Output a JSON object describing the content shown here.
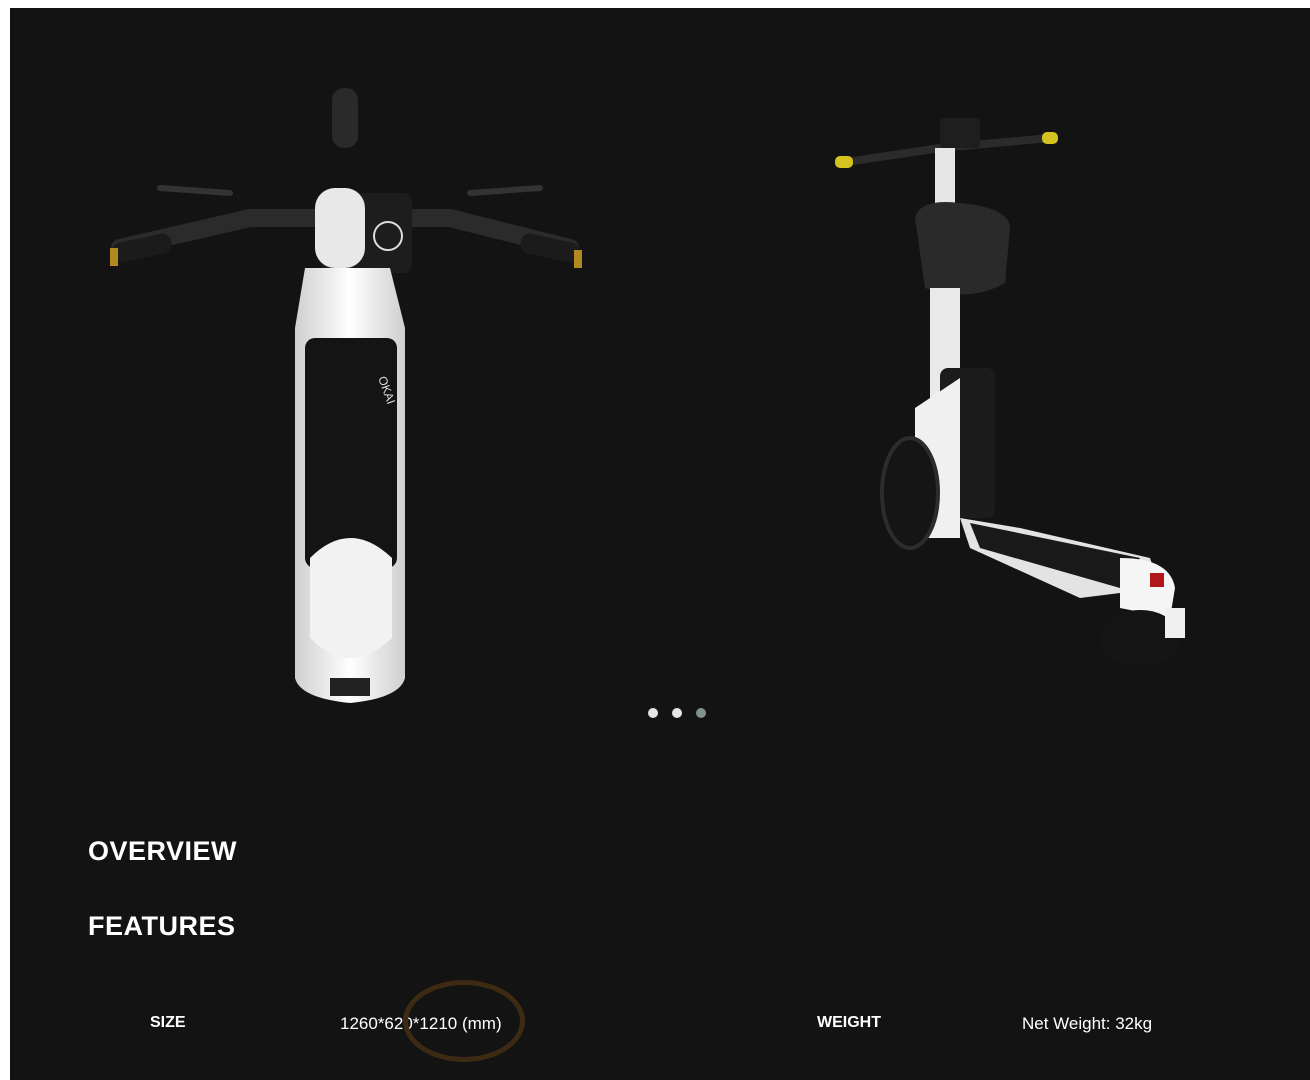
{
  "carousel": {
    "slides": [
      {
        "icon": "scooter-top-view-image"
      },
      {
        "icon": "scooter-rear-three-quarter-view-image"
      }
    ],
    "dot_count": 3,
    "active_dot_index": 2,
    "colors": {
      "dot": "#e6e6e6",
      "dot_active": "#7f928c"
    }
  },
  "nav": {
    "overview_label": "OVERVIEW",
    "features_label": "FEATURES"
  },
  "specs": {
    "size_label": "SIZE",
    "size_value": "1260*620*1210 (mm)",
    "weight_label": "WEIGHT",
    "weight_value": "Net Weight: 32kg"
  },
  "colors": {
    "background": "#131313",
    "text": "#ffffff",
    "annotation": "#3d2a12"
  }
}
